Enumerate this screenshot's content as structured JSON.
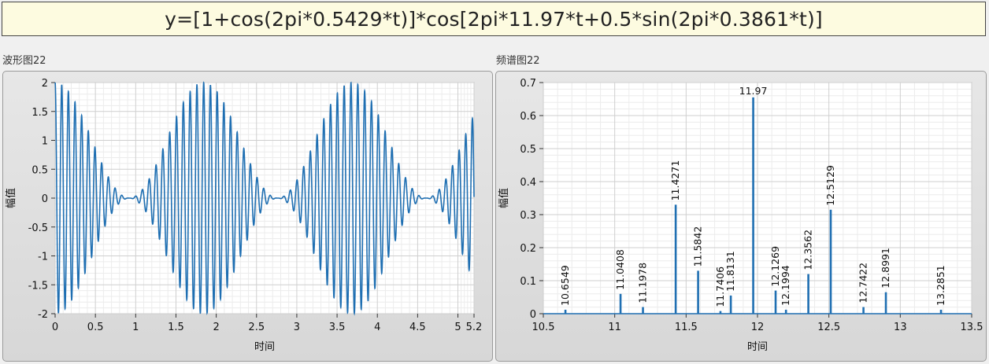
{
  "formula": "y=[1+cos(2pi*0.5429*t)]*cos[2pi*11.97*t+0.5*sin(2pi*0.3861*t)]",
  "colors": {
    "trace": "#1f6fb2",
    "grid_minor": "#ececec",
    "grid_major": "#cfcfcf",
    "plot_bg": "#ffffff",
    "formula_bg": "#fdfbe0"
  },
  "chart_data": [
    {
      "type": "line",
      "panel_title": "波形图22",
      "xlabel": "时间",
      "ylabel": "幅值",
      "xlim": [
        0,
        5.2
      ],
      "ylim": [
        -2,
        2
      ],
      "x_ticks": [
        "0",
        "0.5",
        "1",
        "1.5",
        "2",
        "2.5",
        "3",
        "3.5",
        "4",
        "4.5",
        "5",
        "5.2"
      ],
      "y_ticks": [
        "2",
        "1.5",
        "1",
        "0.5",
        "0",
        "-0.5",
        "-1",
        "-1.5",
        "-2"
      ],
      "grid": true,
      "series": [
        {
          "formula": "y=[1+cos(2pi*0.5429*t)]*cos[2pi*11.97*t+0.5*sin(2pi*0.3861*t)]",
          "amp_mod_freq": 0.5429,
          "carrier_freq": 11.97,
          "phase_mod_index": 0.5,
          "phase_mod_freq": 0.3861
        }
      ]
    },
    {
      "type": "bar",
      "panel_title": "频谱图22",
      "xlabel": "时间",
      "ylabel": "幅值",
      "xlim": [
        10.5,
        13.5
      ],
      "ylim": [
        0,
        0.7
      ],
      "x_ticks": [
        "10.5",
        "11",
        "11.5",
        "12",
        "12.5",
        "13",
        "13.5"
      ],
      "y_ticks": [
        "0.7",
        "0.6",
        "0.5",
        "0.4",
        "0.3",
        "0.2",
        "0.1",
        "0"
      ],
      "grid": true,
      "peaks": [
        {
          "x": 10.6549,
          "y": 0.012,
          "label": "10.6549"
        },
        {
          "x": 11.0408,
          "y": 0.06,
          "label": "11.0408"
        },
        {
          "x": 11.1978,
          "y": 0.02,
          "label": "11.1978"
        },
        {
          "x": 11.4271,
          "y": 0.33,
          "label": "11.4271"
        },
        {
          "x": 11.5842,
          "y": 0.13,
          "label": "11.5842"
        },
        {
          "x": 11.7406,
          "y": 0.008,
          "label": "11.7406"
        },
        {
          "x": 11.8131,
          "y": 0.055,
          "label": "11.8131"
        },
        {
          "x": 11.97,
          "y": 0.655,
          "label": "11.97"
        },
        {
          "x": 12.1269,
          "y": 0.07,
          "label": "12.1269"
        },
        {
          "x": 12.1994,
          "y": 0.012,
          "label": "12.1994"
        },
        {
          "x": 12.3562,
          "y": 0.12,
          "label": "12.3562"
        },
        {
          "x": 12.5129,
          "y": 0.315,
          "label": "12.5129"
        },
        {
          "x": 12.7422,
          "y": 0.02,
          "label": "12.7422"
        },
        {
          "x": 12.8991,
          "y": 0.065,
          "label": "12.8991"
        },
        {
          "x": 13.2851,
          "y": 0.012,
          "label": "13.2851"
        }
      ]
    }
  ]
}
